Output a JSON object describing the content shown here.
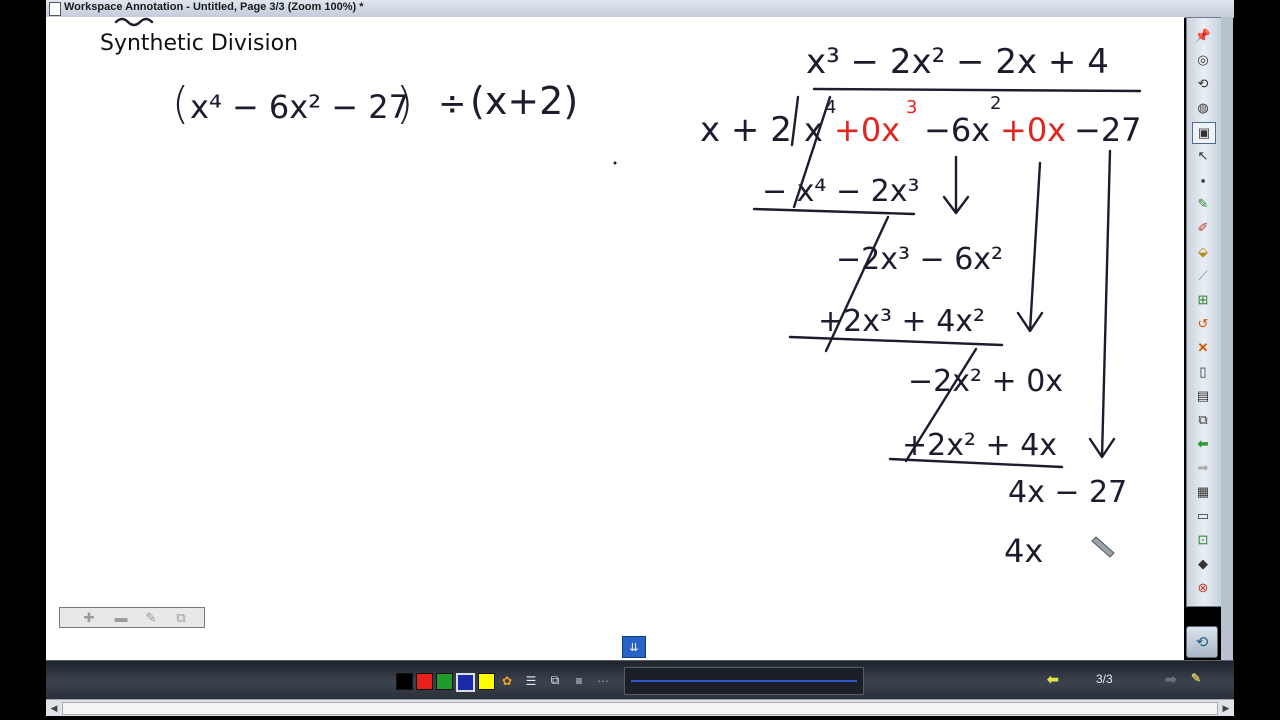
{
  "window": {
    "title": "Workspace Annotation - Untitled, Page 3/3  (Zoom 100%) *"
  },
  "page": {
    "heading": "Synthetic Division",
    "problem": {
      "open": "(",
      "dividend": "x⁴ − 6x² − 27",
      "close": ")",
      "divide_sign": "÷",
      "divisor": "(x+2)"
    },
    "long_division": {
      "quotient": "x³ − 2x² − 2x + 4",
      "divisor": "x + 2",
      "dividend_terms": [
        {
          "text": "x",
          "exp": "4",
          "color": "#1c1c2e"
        },
        {
          "text": "+0x",
          "exp": "3",
          "color": "#e0261e"
        },
        {
          "text": "−6x",
          "exp": "2",
          "color": "#1c1c2e"
        },
        {
          "text": "+0x",
          "exp": "",
          "color": "#e0261e"
        },
        {
          "text": "−27",
          "exp": "",
          "color": "#1c1c2e"
        }
      ],
      "steps": [
        "− x⁴ − 2x³",
        "−2x³ − 6x²",
        "+2x³ + 4x²",
        "−2x² + 0x",
        "+2x² + 4x",
        "4x − 27",
        "4x"
      ]
    }
  },
  "side_toolbar": {
    "icons": [
      "pin-icon",
      "zoom-icon",
      "undo-icon",
      "eraser-icon",
      "capture-icon",
      "pointer-icon",
      "screen-icon",
      "pen-icon",
      "highlighter-icon",
      "fill-icon",
      "line-icon",
      "insert-page-icon",
      "clear-icon",
      "delete-icon",
      "new-page-icon",
      "page-icon",
      "copy-page-icon",
      "previous-page-icon",
      "next-page-icon",
      "table-icon",
      "save-icon",
      "gallery-icon",
      "eraser-tool-icon",
      "close-icon"
    ]
  },
  "bottom_toolbar": {
    "colors": [
      "#000000",
      "#e8201a",
      "#1f9a2b",
      "#1a2aa8",
      "#ffff00"
    ],
    "page_indicator": "3/3"
  }
}
